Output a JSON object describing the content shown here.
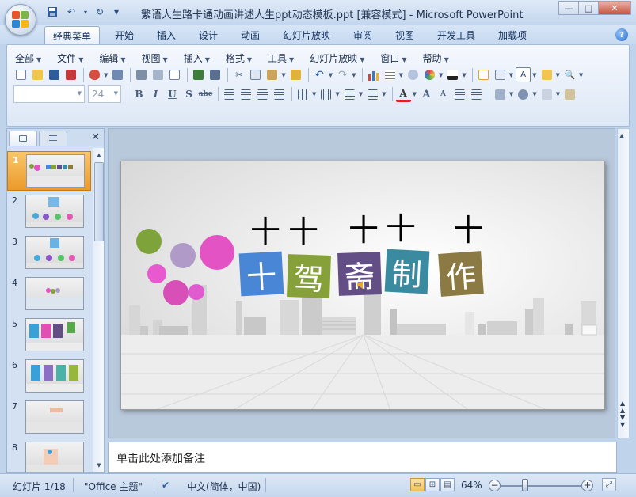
{
  "window": {
    "title": "繁语人生路卡通动画讲述人生ppt动态模板.ppt [兼容模式] - Microsoft PowerPoint",
    "minimize": "—",
    "maximize": "□",
    "close": "✕"
  },
  "quick_access": {
    "save": "save-icon",
    "undo": "↶",
    "redo": "↻",
    "customize": "▾"
  },
  "tabs": [
    "经典菜单",
    "开始",
    "插入",
    "设计",
    "动画",
    "幻灯片放映",
    "审阅",
    "视图",
    "开发工具",
    "加载项"
  ],
  "help": "?",
  "menu": [
    "全部",
    "文件",
    "编辑",
    "视图",
    "插入",
    "格式",
    "工具",
    "幻灯片放映",
    "窗口",
    "帮助"
  ],
  "format_bar": {
    "font_name": "",
    "font_size": "24",
    "bold": "B",
    "italic": "I",
    "underline": "U",
    "shadow": "S",
    "strike": "abc",
    "font_color": "A"
  },
  "slide": {
    "title_chars": [
      "十",
      "驾",
      "斋",
      "制",
      "作"
    ],
    "title_colors": [
      "#4a86d6",
      "#86a03a",
      "#634e86",
      "#3a8aa0",
      "#8b7a43"
    ],
    "accent_colors": [
      "#7fa33b",
      "#b09ac8",
      "#e453c4",
      "#e858cf",
      "#d84fb8",
      "#e05bd0"
    ],
    "hanging_marks": [
      "十",
      "十",
      "十",
      "十",
      "十"
    ]
  },
  "thumbnails": [
    {
      "num": "1",
      "selected": true
    },
    {
      "num": "2",
      "selected": false
    },
    {
      "num": "3",
      "selected": false
    },
    {
      "num": "4",
      "selected": false
    },
    {
      "num": "5",
      "selected": false
    },
    {
      "num": "6",
      "selected": false
    },
    {
      "num": "7",
      "selected": false
    },
    {
      "num": "8",
      "selected": false
    }
  ],
  "notes_placeholder": "单击此处添加备注",
  "status": {
    "slide_index": "幻灯片 1/18",
    "theme": "\"Office 主题\"",
    "language": "中文(简体，中国)",
    "zoom": "64%",
    "zoom_fraction": 0.64
  }
}
